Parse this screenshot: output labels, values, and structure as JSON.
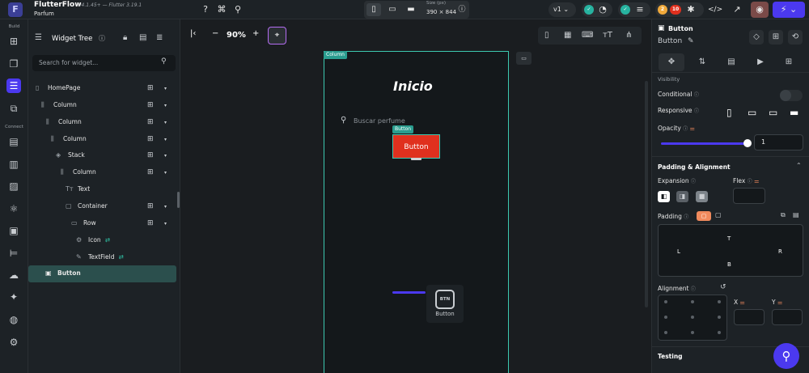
{
  "app": {
    "name": "FlutterFlow",
    "version": "v4.1.45+ — Flutter 3.19.1",
    "project": "Parfum"
  },
  "toolbar": {
    "size_label": "Size (px)",
    "size_value": "390 × 844",
    "version": "v1",
    "badge_warn": "2",
    "badge_err": "10"
  },
  "leftnav": {
    "build": "Build",
    "connect": "Connect"
  },
  "tree": {
    "title": "Widget Tree",
    "search_placeholder": "Search for widget...",
    "nodes": [
      "HomePage",
      "Column",
      "Column",
      "Column",
      "Stack",
      "Column",
      "Text",
      "Container",
      "Row",
      "Icon",
      "TextField",
      "Button"
    ]
  },
  "canvas": {
    "zoom": "90%",
    "frame_tag": "Column",
    "title": "Inicio",
    "search_placeholder": "Buscar perfume",
    "button_tag": "Button",
    "button_text": "Button",
    "drag_icon": "BTN",
    "drag_label": "Button"
  },
  "props": {
    "widget_type": "Button",
    "widget_name": "Button",
    "visibility": "Visibility",
    "conditional": "Conditional",
    "responsive": "Responsive",
    "opacity": "Opacity",
    "opacity_value": "1",
    "padding_alignment": "Padding & Alignment",
    "expansion": "Expansion",
    "flex": "Flex",
    "padding": "Padding",
    "pad_t": "T",
    "pad_l": "L",
    "pad_r": "R",
    "pad_b": "B",
    "alignment": "Alignment",
    "x": "X",
    "y": "Y",
    "testing": "Testing"
  },
  "colors": {
    "accent": "#4b39ef",
    "teal": "#2a9d8f",
    "button": "#e0301e"
  }
}
